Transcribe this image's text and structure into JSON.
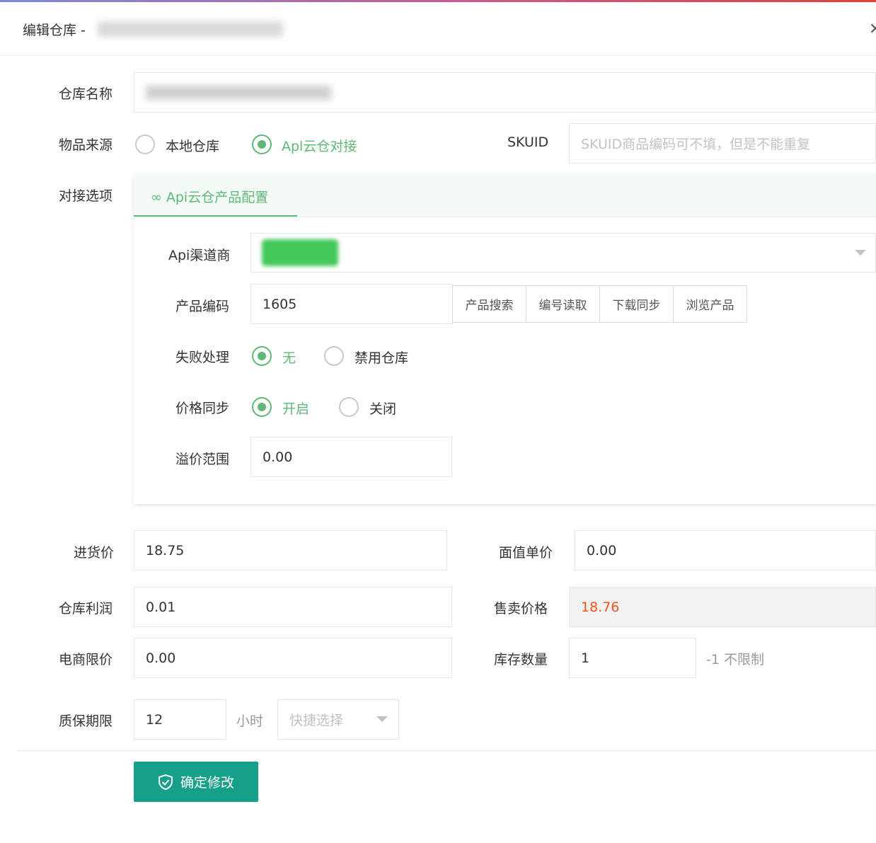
{
  "header": {
    "title": "编辑仓库 -",
    "close_icon": "close-icon"
  },
  "form": {
    "name": {
      "label": "仓库名称",
      "value": ""
    },
    "source": {
      "label": "物品来源",
      "options": [
        "本地仓库",
        "Apl云仓对接"
      ],
      "selected": 1
    },
    "skuid": {
      "label": "SKUID",
      "placeholder": "SKUID商品编码可不填，但是不能重复"
    },
    "docking": {
      "label": "对接选项"
    },
    "purchase_price": {
      "label": "进货价",
      "value": "18.75"
    },
    "face_value": {
      "label": "面值单价",
      "value": "0.00"
    },
    "profit": {
      "label": "仓库利润",
      "value": "0.01"
    },
    "sell_price": {
      "label": "售卖价格",
      "value": "18.76"
    },
    "ecom_limit": {
      "label": "电商限价",
      "value": "0.00"
    },
    "stock": {
      "label": "库存数量",
      "value": "1",
      "hint": "-1 不限制"
    },
    "warranty": {
      "label": "质保期限",
      "value": "12",
      "unit": "小时",
      "quick_placeholder": "快捷选择"
    },
    "submit_label": "确定修改"
  },
  "panel": {
    "tab_label": "Api云仓产品配置",
    "channel": {
      "label": "Api渠道商"
    },
    "product_code": {
      "label": "产品编码",
      "value": "1605",
      "buttons": [
        "产品搜索",
        "编号读取",
        "下载同步",
        "浏览产品"
      ]
    },
    "fail": {
      "label": "失败处理",
      "options": [
        "无",
        "禁用仓库"
      ],
      "selected": 0
    },
    "price_sync": {
      "label": "价格同步",
      "options": [
        "开启",
        "关闭"
      ],
      "selected": 0
    },
    "premium": {
      "label": "溢价范围",
      "value": "0.00"
    }
  },
  "colors": {
    "accent": "#5fb878",
    "primary_button": "#16a08a",
    "sell_price": "#f0521d"
  }
}
